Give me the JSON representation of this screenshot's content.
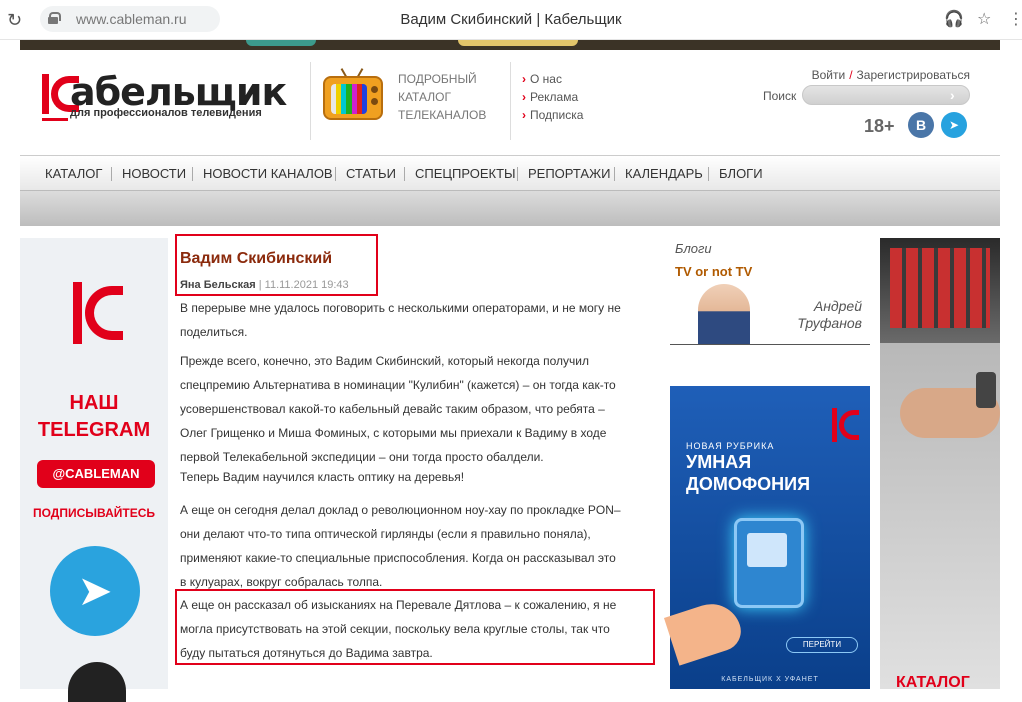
{
  "browser": {
    "url": "www.cableman.ru",
    "tab_title": "Вадим Скибинский | Кабельщик",
    "reload_glyph": "↻",
    "headphones_glyph": "🎧",
    "star_glyph": "☆",
    "menu_glyph": "⋮"
  },
  "header": {
    "logo_text": "абельщик",
    "logo_sub": "для профессионалов телевидения",
    "catalog_lines": [
      "ПОДРОБНЫЙ",
      "КАТАЛОГ",
      "ТЕЛЕКАНАЛОВ"
    ],
    "info_links": [
      "О нас",
      "Реклама",
      "Подписка"
    ],
    "info_arrow": "›",
    "login": "Войти",
    "auth_sep": "/",
    "register": "Зарегистрироваться",
    "search_label": "Поиск",
    "search_value": "",
    "search_go": "›",
    "age": "18+",
    "vk_label": "В",
    "tg_label": "➤",
    "tv_colors": [
      "#e8e8e8",
      "#f0d000",
      "#00c8d0",
      "#20b020",
      "#d020d0",
      "#e02020",
      "#2040e0"
    ]
  },
  "nav": {
    "items": [
      "КАТАЛОГ",
      "НОВОСТИ",
      "НОВОСТИ КАНАЛОВ",
      "СТАТЬИ",
      "СПЕЦПРОЕКТЫ",
      "РЕПОРТАЖИ",
      "КАЛЕНДАРЬ",
      "БЛОГИ"
    ]
  },
  "left_ad": {
    "line1": "НАШ",
    "line2": "TELEGRAM",
    "button": "@CABLEMAN",
    "subscribe": "ПОДПИСЫВАЙТЕСЬ",
    "tg_glyph": "➤"
  },
  "article": {
    "title": "Вадим Скибинский",
    "author": "Яна Бельская",
    "meta_sep": "|",
    "date": "11.11.2021 19:43",
    "paragraphs": [
      [
        "В перерыве мне удалось поговорить с несколькими операторами, и не могу не",
        "поделиться."
      ],
      [
        "Прежде всего, конечно, это Вадим Скибинский, который некогда получил",
        "спецпремию Альтернатива в номинации \"Кулибин\" (кажется) – он тогда как-то",
        "усовершенствовал какой-то кабельный девайс таким образом, что ребята –",
        "Олег Грищенко и Миша Фоминых, с которыми мы приехали к Вадиму в ходе",
        "первой Телекабельной экспедиции – они тогда просто обалдели."
      ],
      [
        "Теперь Вадим научился класть оптику на деревья!"
      ],
      [
        "А еще он сегодня делал доклад о революционном ноу-хау по прокладке PON–",
        "они делают что-то типа оптической гирлянды (если я правильно поняла),",
        "применяют какие-то специальные приспособления. Когда он рассказывал это",
        "в кулуарах, вокруг собралась толпа."
      ],
      [
        "А еще он рассказал об изысканиях на Перевале Дятлова – к сожалению, я не",
        "могла присутствовать на этой секции, поскольку вела круглые столы, так что",
        "буду пытаться дотянуться до Вадима завтра."
      ]
    ]
  },
  "blogs": {
    "label": "Блоги",
    "title": "TV or not TV",
    "name_first": "Андрей",
    "name_last": "Труфанов"
  },
  "mid_ad": {
    "rubric": "НОВАЯ РУБРИКА",
    "line1": "УМНАЯ",
    "line2": "ДОМОФОНИЯ",
    "button": "ПЕРЕЙТИ",
    "footer": "КАБЕЛЬЩИК Х УФАНЕТ"
  },
  "right_ad": {
    "caption": "КАТАЛОГ"
  }
}
